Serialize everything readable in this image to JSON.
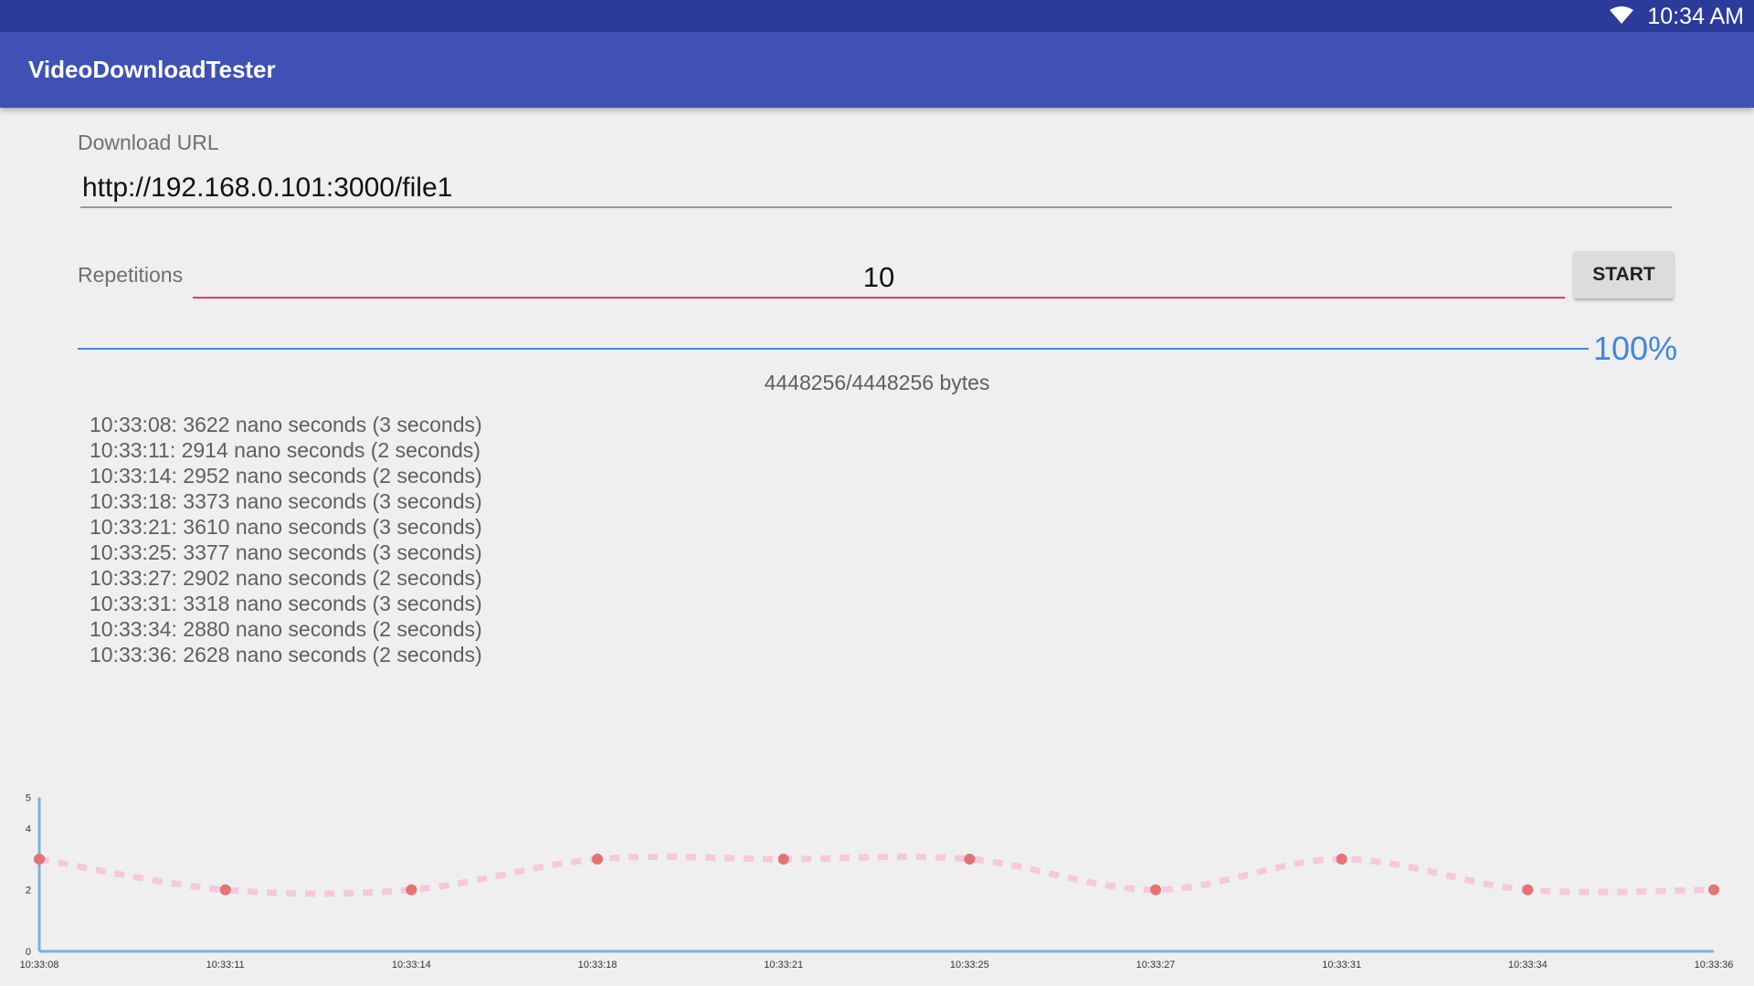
{
  "status_bar": {
    "time": "10:34 AM",
    "wifi_icon": "wifi-icon"
  },
  "app_bar": {
    "title": "VideoDownloadTester"
  },
  "form": {
    "url_label": "Download URL",
    "url_value": "http://192.168.0.101:3000/file1",
    "repetitions_label": "Repetitions",
    "repetitions_value": "10",
    "start_label": "START"
  },
  "progress": {
    "fraction": 1.0,
    "percent_text": "100%",
    "bytes_text": "4448256/4448256 bytes"
  },
  "results": [
    "10:33:08: 3622 nano seconds (3 seconds)",
    "10:33:11: 2914 nano seconds (2 seconds)",
    "10:33:14: 2952 nano seconds (2 seconds)",
    "10:33:18: 3373 nano seconds (3 seconds)",
    "10:33:21: 3610 nano seconds (3 seconds)",
    "10:33:25: 3377 nano seconds (3 seconds)",
    "10:33:27: 2902 nano seconds (2 seconds)",
    "10:33:31: 3318 nano seconds (3 seconds)",
    "10:33:34: 2880 nano seconds (2 seconds)",
    "10:33:36: 2628 nano seconds (2 seconds)"
  ],
  "colors": {
    "status_bar": "#2c3b9a",
    "app_bar": "#3f51b5",
    "accent_pink": "#e4376e",
    "progress_blue": "#3f87e0",
    "chart_axis": "#7fb0dc",
    "chart_line": "#f6c8de",
    "chart_point": "#e57373"
  },
  "chart_data": {
    "type": "line",
    "x": [
      "10:33:08",
      "10:33:11",
      "10:33:14",
      "10:33:18",
      "10:33:21",
      "10:33:25",
      "10:33:27",
      "10:33:31",
      "10:33:34",
      "10:33:36"
    ],
    "values": [
      3,
      2,
      2,
      3,
      3,
      3,
      2,
      3,
      2,
      2
    ],
    "y_ticks": [
      0,
      2,
      4,
      5
    ],
    "ylim": [
      0,
      6
    ],
    "line_style": "dashed-smooth",
    "grid": false
  }
}
